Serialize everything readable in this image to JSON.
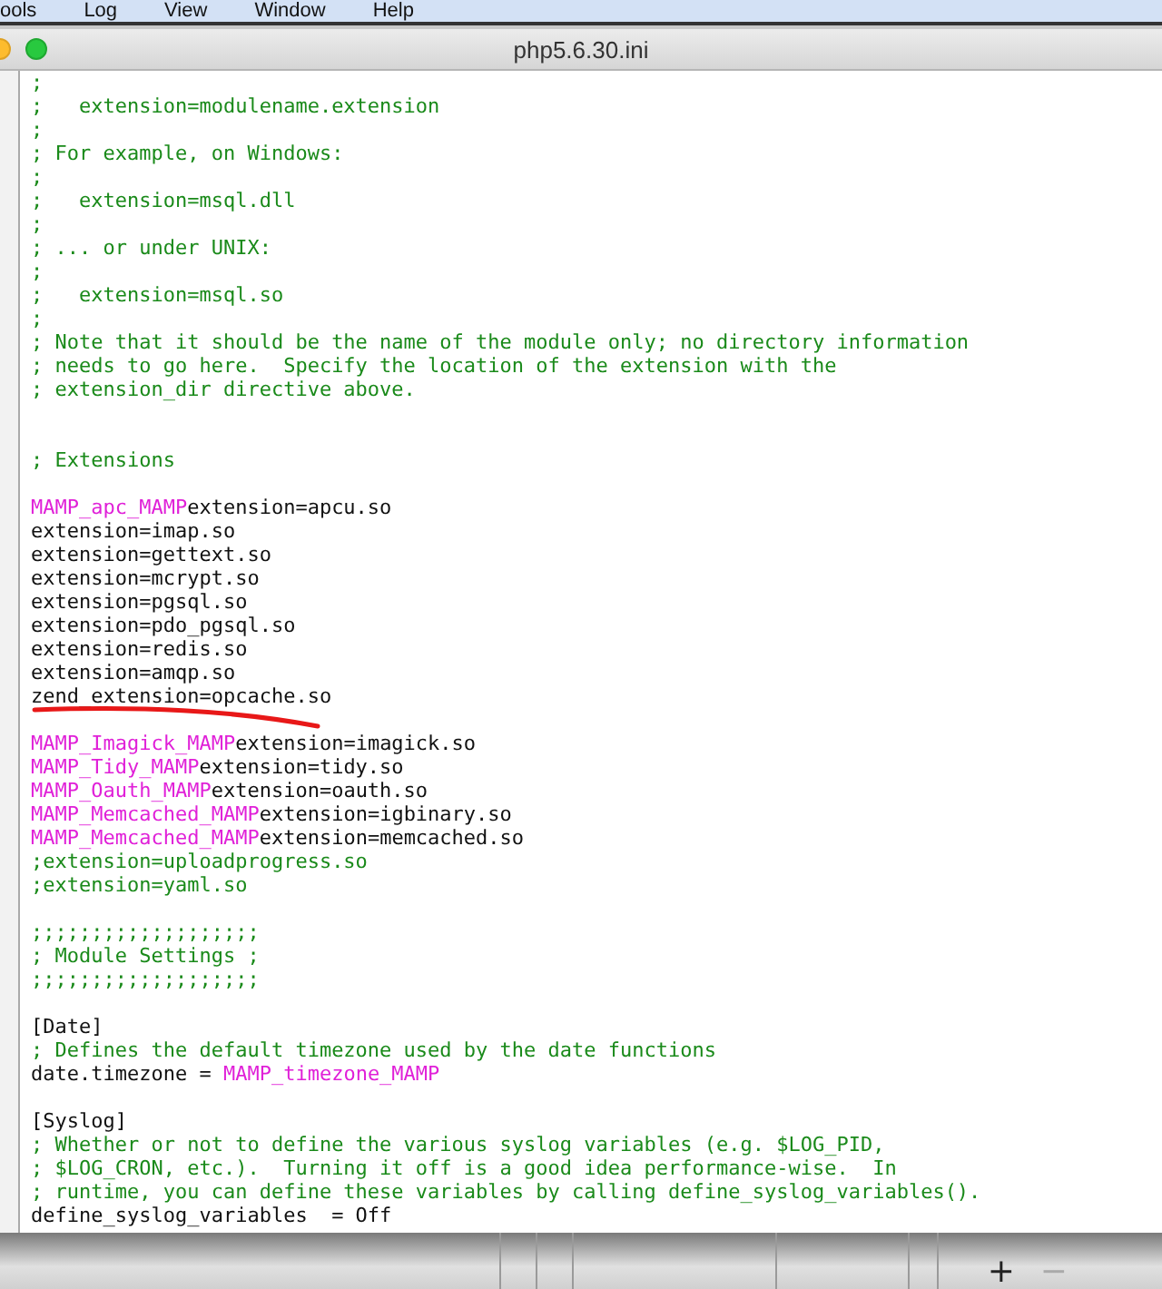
{
  "menu_bar": {
    "items": [
      "ools",
      "Log",
      "View",
      "Window",
      "Help"
    ]
  },
  "window": {
    "title": "php5.6.30.ini"
  },
  "editor": {
    "lines": [
      {
        "kind": "code",
        "parts": [
          {
            "kind": "comment",
            "text": ";"
          }
        ]
      },
      {
        "kind": "code",
        "parts": [
          {
            "kind": "comment",
            "text": ";   extension=modulename.extension"
          }
        ]
      },
      {
        "kind": "code",
        "parts": [
          {
            "kind": "comment",
            "text": ";"
          }
        ]
      },
      {
        "kind": "code",
        "parts": [
          {
            "kind": "comment",
            "text": "; For example, on Windows:"
          }
        ]
      },
      {
        "kind": "code",
        "parts": [
          {
            "kind": "comment",
            "text": ";"
          }
        ]
      },
      {
        "kind": "code",
        "parts": [
          {
            "kind": "comment",
            "text": ";   extension=msql.dll"
          }
        ]
      },
      {
        "kind": "code",
        "parts": [
          {
            "kind": "comment",
            "text": ";"
          }
        ]
      },
      {
        "kind": "code",
        "parts": [
          {
            "kind": "comment",
            "text": "; ... or under UNIX:"
          }
        ]
      },
      {
        "kind": "code",
        "parts": [
          {
            "kind": "comment",
            "text": ";"
          }
        ]
      },
      {
        "kind": "code",
        "parts": [
          {
            "kind": "comment",
            "text": ";   extension=msql.so"
          }
        ]
      },
      {
        "kind": "code",
        "parts": [
          {
            "kind": "comment",
            "text": ";"
          }
        ]
      },
      {
        "kind": "code",
        "parts": [
          {
            "kind": "comment",
            "text": "; Note that it should be the name of the module only; no directory information"
          }
        ]
      },
      {
        "kind": "code",
        "parts": [
          {
            "kind": "comment",
            "text": "; needs to go here.  Specify the location of the extension with the"
          }
        ]
      },
      {
        "kind": "code",
        "parts": [
          {
            "kind": "comment",
            "text": "; extension_dir directive above."
          }
        ]
      },
      {
        "kind": "blank"
      },
      {
        "kind": "blank"
      },
      {
        "kind": "code",
        "parts": [
          {
            "kind": "comment",
            "text": "; Extensions"
          }
        ]
      },
      {
        "kind": "blank"
      },
      {
        "kind": "code",
        "parts": [
          {
            "kind": "macro",
            "text": "MAMP_apc_MAMP"
          },
          {
            "kind": "plain",
            "text": "extension=apcu.so"
          }
        ]
      },
      {
        "kind": "code",
        "parts": [
          {
            "kind": "plain",
            "text": "extension=imap.so"
          }
        ]
      },
      {
        "kind": "code",
        "parts": [
          {
            "kind": "plain",
            "text": "extension=gettext.so"
          }
        ]
      },
      {
        "kind": "code",
        "parts": [
          {
            "kind": "plain",
            "text": "extension=mcrypt.so"
          }
        ]
      },
      {
        "kind": "code",
        "parts": [
          {
            "kind": "plain",
            "text": "extension=pgsql.so"
          }
        ]
      },
      {
        "kind": "code",
        "parts": [
          {
            "kind": "plain",
            "text": "extension=pdo_pgsql.so"
          }
        ]
      },
      {
        "kind": "code",
        "parts": [
          {
            "kind": "plain",
            "text": "extension=redis.so"
          }
        ]
      },
      {
        "kind": "code",
        "parts": [
          {
            "kind": "plain",
            "text": "extension=amqp.so"
          }
        ]
      },
      {
        "kind": "code",
        "underlined": true,
        "parts": [
          {
            "kind": "plain",
            "text": "zend_extension=opcache.so"
          }
        ]
      },
      {
        "kind": "blank"
      },
      {
        "kind": "code",
        "parts": [
          {
            "kind": "macro",
            "text": "MAMP_Imagick_MAMP"
          },
          {
            "kind": "plain",
            "text": "extension=imagick.so"
          }
        ]
      },
      {
        "kind": "code",
        "parts": [
          {
            "kind": "macro",
            "text": "MAMP_Tidy_MAMP"
          },
          {
            "kind": "plain",
            "text": "extension=tidy.so"
          }
        ]
      },
      {
        "kind": "code",
        "parts": [
          {
            "kind": "macro",
            "text": "MAMP_Oauth_MAMP"
          },
          {
            "kind": "plain",
            "text": "extension=oauth.so"
          }
        ]
      },
      {
        "kind": "code",
        "parts": [
          {
            "kind": "macro",
            "text": "MAMP_Memcached_MAMP"
          },
          {
            "kind": "plain",
            "text": "extension=igbinary.so"
          }
        ]
      },
      {
        "kind": "code",
        "parts": [
          {
            "kind": "macro",
            "text": "MAMP_Memcached_MAMP"
          },
          {
            "kind": "plain",
            "text": "extension=memcached.so"
          }
        ]
      },
      {
        "kind": "code",
        "parts": [
          {
            "kind": "comment",
            "text": ";extension=uploadprogress.so"
          }
        ]
      },
      {
        "kind": "code",
        "parts": [
          {
            "kind": "comment",
            "text": ";extension=yaml.so"
          }
        ]
      },
      {
        "kind": "blank"
      },
      {
        "kind": "code",
        "parts": [
          {
            "kind": "comment",
            "text": ";;;;;;;;;;;;;;;;;;;"
          }
        ]
      },
      {
        "kind": "code",
        "parts": [
          {
            "kind": "comment",
            "text": "; Module Settings ;"
          }
        ]
      },
      {
        "kind": "code",
        "parts": [
          {
            "kind": "comment",
            "text": ";;;;;;;;;;;;;;;;;;;"
          }
        ]
      },
      {
        "kind": "blank"
      },
      {
        "kind": "code",
        "parts": [
          {
            "kind": "plain",
            "text": "[Date]"
          }
        ]
      },
      {
        "kind": "code",
        "parts": [
          {
            "kind": "comment",
            "text": "; Defines the default timezone used by the date functions"
          }
        ]
      },
      {
        "kind": "code",
        "parts": [
          {
            "kind": "plain",
            "text": "date.timezone = "
          },
          {
            "kind": "macro",
            "text": "MAMP_timezone_MAMP"
          }
        ]
      },
      {
        "kind": "blank"
      },
      {
        "kind": "code",
        "parts": [
          {
            "kind": "plain",
            "text": "[Syslog]"
          }
        ]
      },
      {
        "kind": "code",
        "parts": [
          {
            "kind": "comment",
            "text": "; Whether or not to define the various syslog variables (e.g. $LOG_PID,"
          }
        ]
      },
      {
        "kind": "code",
        "parts": [
          {
            "kind": "comment",
            "text": "; $LOG_CRON, etc.).  Turning it off is a good idea performance-wise.  In"
          }
        ]
      },
      {
        "kind": "code",
        "parts": [
          {
            "kind": "comment",
            "text": "; runtime, you can define these variables by calling define_syslog_variables()."
          }
        ]
      },
      {
        "kind": "code",
        "parts": [
          {
            "kind": "plain",
            "text": "define_syslog_variables  = Off"
          }
        ]
      }
    ]
  },
  "bottom_bar": {
    "buttons": [
      "+",
      "−"
    ]
  }
}
